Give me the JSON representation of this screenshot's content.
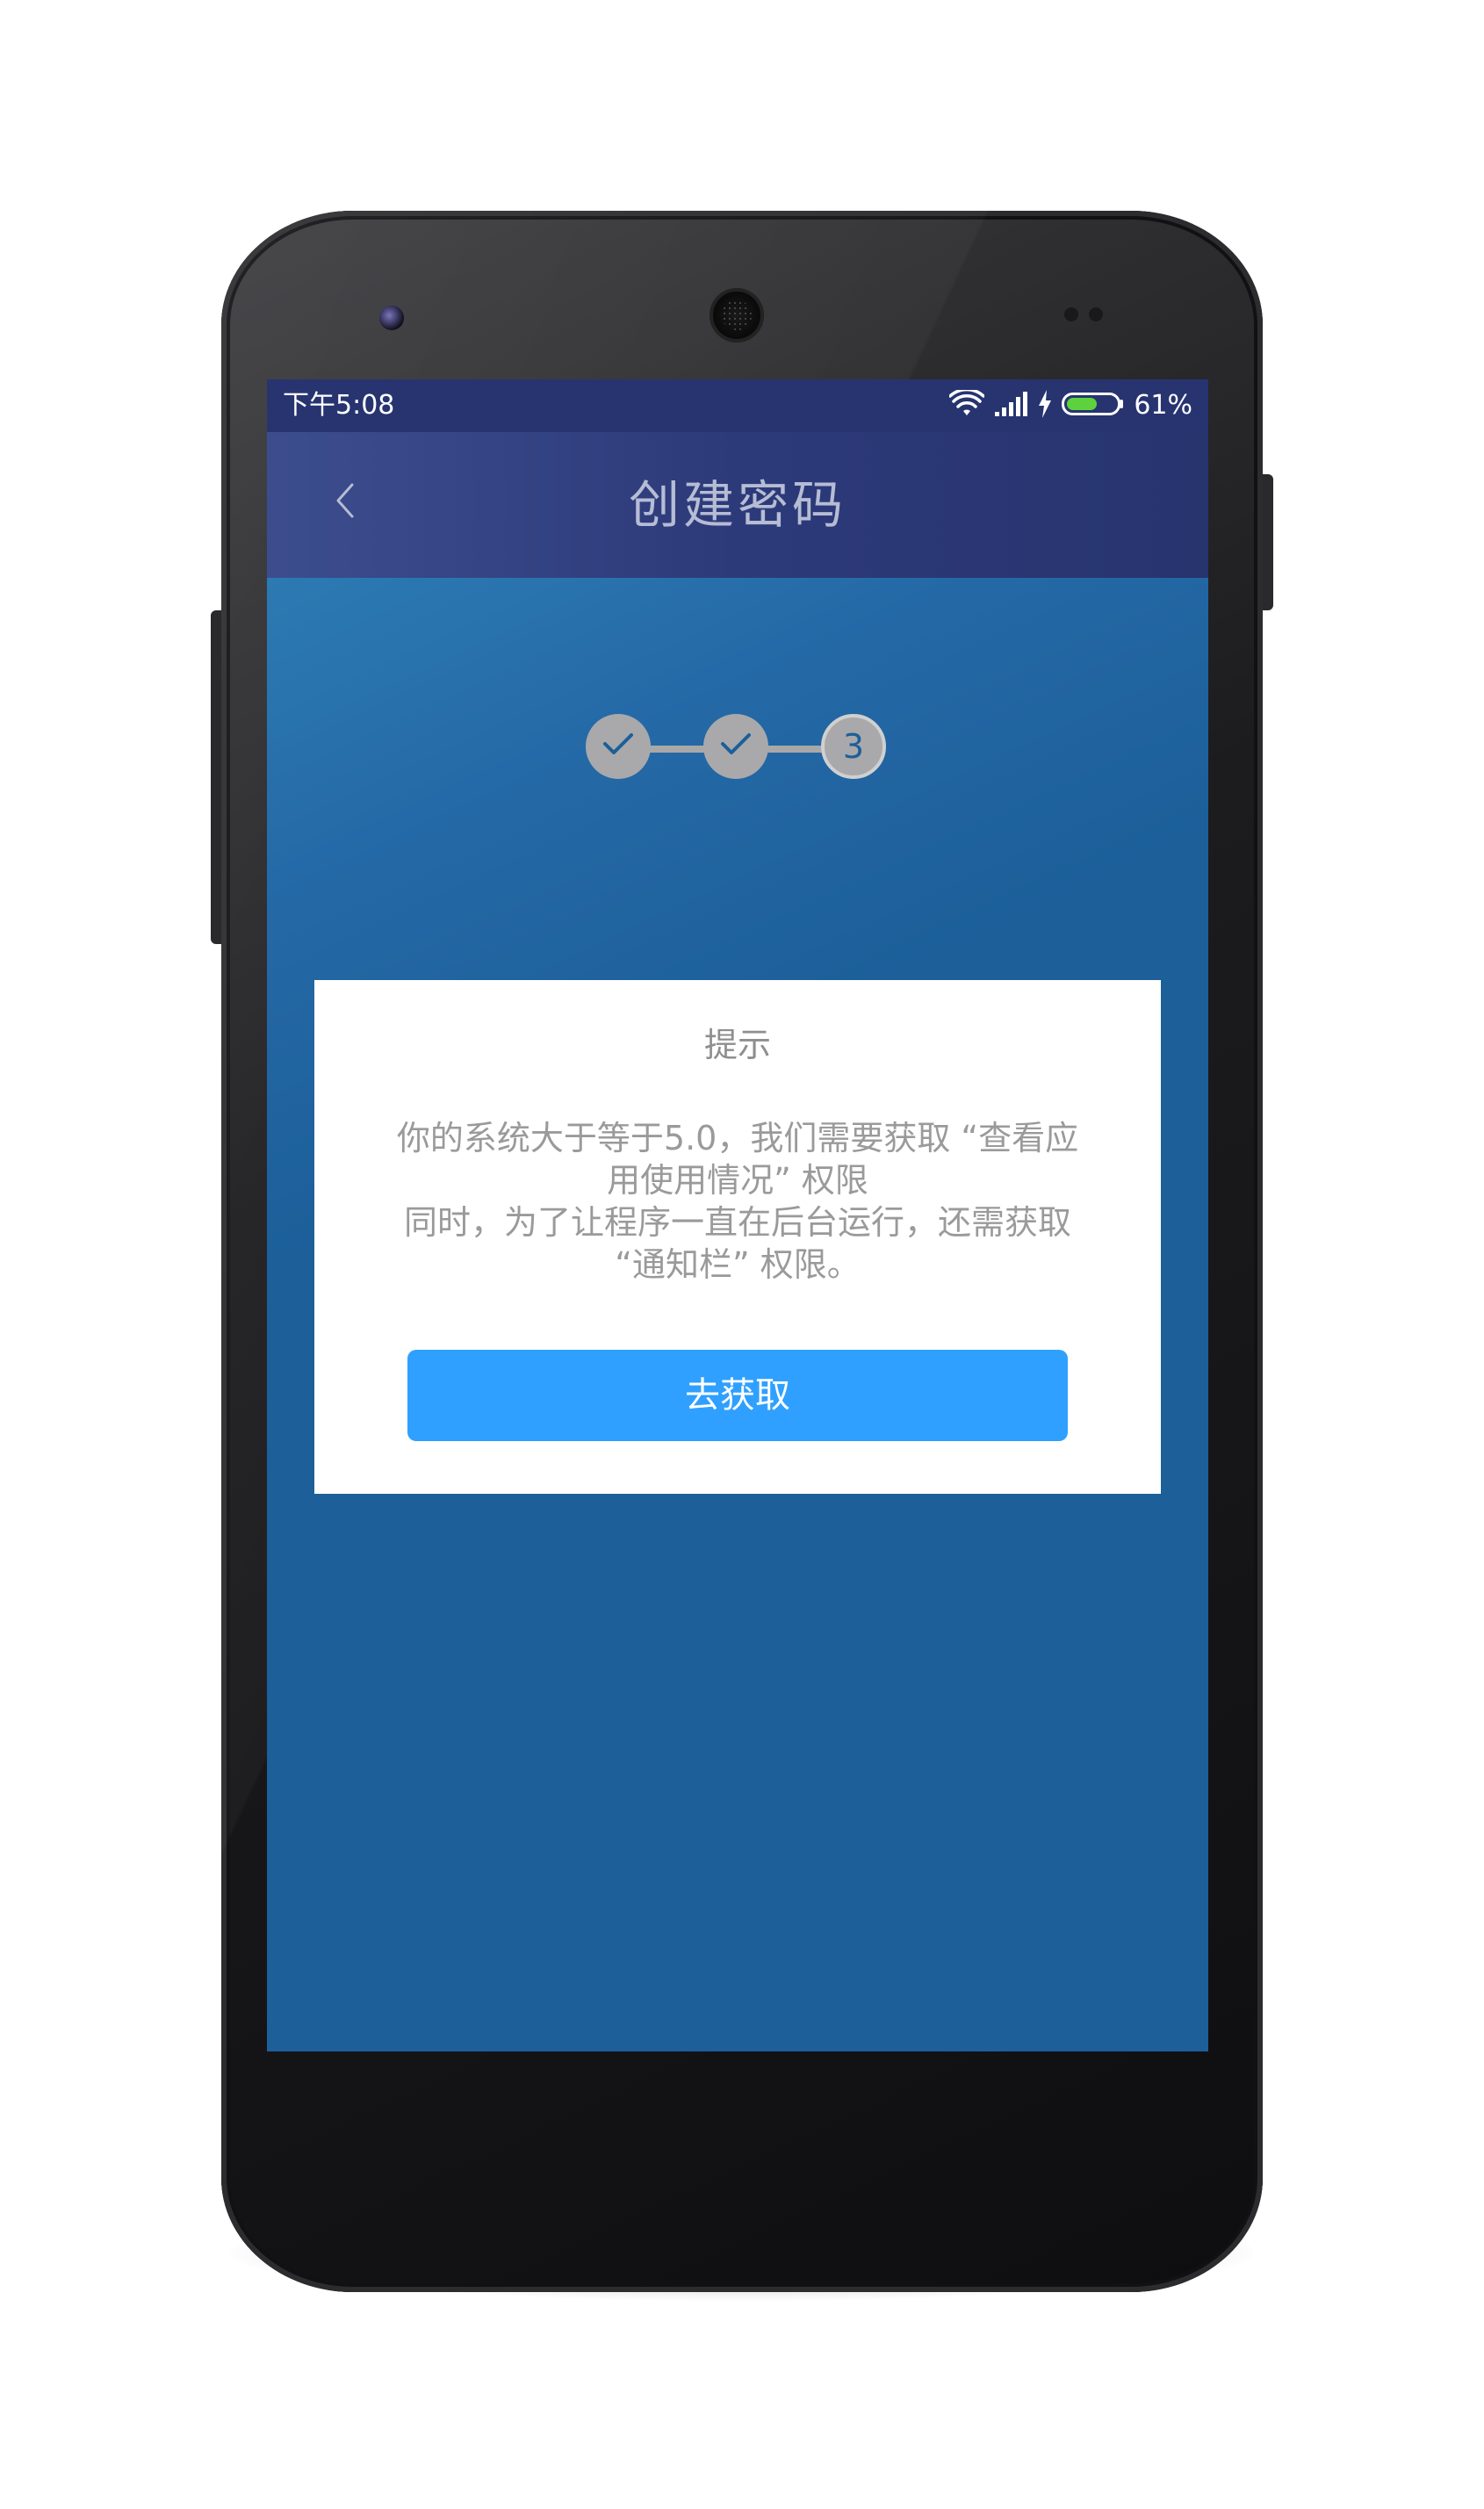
{
  "statusbar": {
    "time": "下午5:08",
    "battery_percent_label": "61%",
    "battery_level": 0.61,
    "icons": [
      "wifi-icon",
      "signal-icon",
      "charging-bolt-icon",
      "battery-icon"
    ]
  },
  "appbar": {
    "title": "创建密码",
    "back_icon": "chevron-left-icon"
  },
  "steps": {
    "items": [
      {
        "state": "done",
        "icon": "check-icon"
      },
      {
        "state": "done",
        "icon": "check-icon"
      },
      {
        "state": "current",
        "label": "3"
      }
    ]
  },
  "dialog": {
    "title": "提示",
    "message_lines": [
      "你的系统大于等于5.0，我们需要获取 “查看应",
      "用使用情况” 权限",
      "同时，为了让程序一直在后台运行，还需获取",
      "“通知栏” 权限。"
    ],
    "button_label": "去获取"
  },
  "colors": {
    "statusbar": "#273470",
    "appbar": "#2d3a7a",
    "content_bg": "#1c5f99",
    "step_circle": "#a9a9ab",
    "button": "#2fa0ff",
    "battery_fill": "#5dd23c"
  }
}
